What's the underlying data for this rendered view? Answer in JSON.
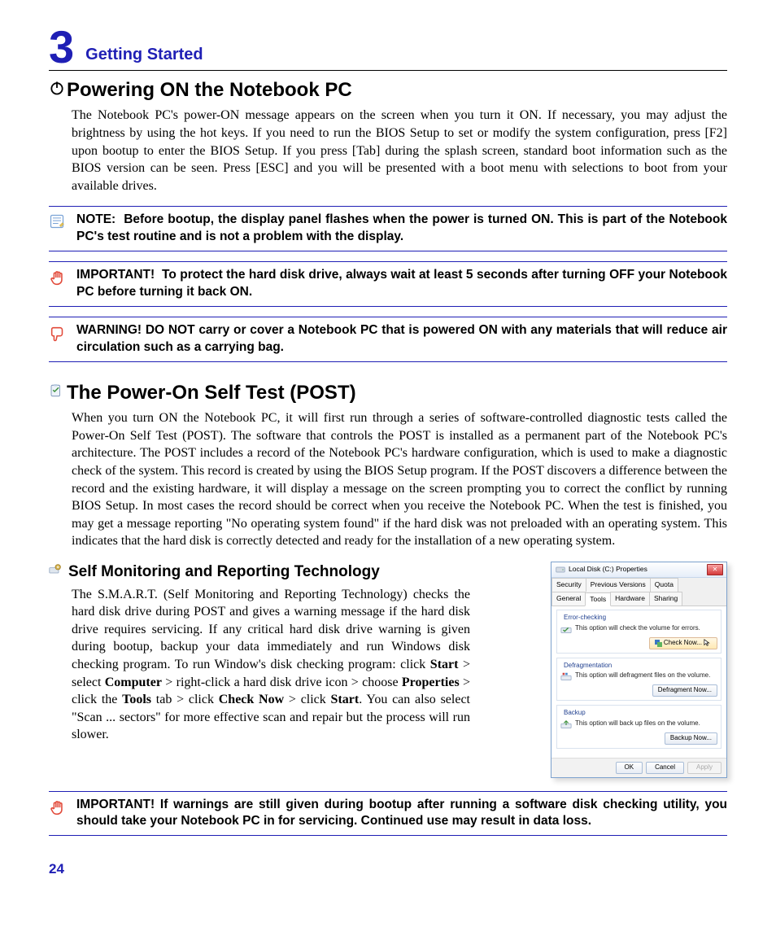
{
  "chapter": {
    "number": "3",
    "title": "Getting Started"
  },
  "section1": {
    "title": "Powering ON the Notebook PC",
    "body": "The Notebook PC's power-ON message appears on the screen when you turn it ON. If necessary, you may adjust the brightness by using the hot keys. If you need to run the BIOS Setup to set or modify the system configuration, press [F2] upon bootup to enter the BIOS Setup. If you press [Tab] during the splash screen, standard boot information such as the BIOS version can be seen. Press [ESC] and you will be presented with a boot menu with selections to boot from your available drives."
  },
  "note": {
    "label": "NOTE:",
    "text": "Before bootup, the display panel flashes when the power is turned ON. This is part of the Notebook PC's test routine and is not a problem with the display."
  },
  "important1": {
    "label": "IMPORTANT!",
    "text": "To protect the hard disk drive, always wait at least 5 seconds after turning OFF your Notebook PC before turning it back ON."
  },
  "warning": {
    "label": "WARNING!",
    "text": "DO NOT carry or cover a Notebook PC that is powered ON with any materials that will reduce air circulation such as a carrying bag."
  },
  "section2": {
    "title": "The Power-On Self Test (POST)",
    "body": "When you turn ON the Notebook PC, it will first run through a series of software-controlled diagnostic tests called the Power-On Self Test (POST). The software that controls the POST is installed as a permanent part of the Notebook PC's architecture. The POST includes a record of the Notebook PC's hardware configuration, which is used to make a diagnostic check of the system. This record is created by using the BIOS Setup program. If the POST discovers a difference between the record and the existing hardware, it will display a message on the screen prompting you to correct the conflict by running BIOS Setup. In most cases the record should be correct when you receive the Notebook PC. When the test is finished, you may get a message reporting \"No operating system found\" if the hard disk was not preloaded with an operating system. This indicates that the hard disk is correctly detected and ready for the installation of a new operating system."
  },
  "subsection": {
    "title": "Self Monitoring and Reporting Technology",
    "body_pre": "The S.M.A.R.T. (Self Monitoring and Reporting Technology) checks the hard disk drive during POST and gives a warning message if the hard disk drive requires servicing. If any critical hard disk drive warning is given during bootup, backup your data immediately and run Windows disk checking program. To run Window's disk checking program: click ",
    "b1": "Start",
    "t1": " > select ",
    "b2": "Computer",
    "t2": " > right-click a hard disk drive icon > choose ",
    "b3": "Properties",
    "t3": " > click the ",
    "b4": "Tools",
    "t4": " tab > click ",
    "b5": "Check Now",
    "t5": " > click ",
    "b6": "Start",
    "t6": ". You can also select \"Scan ... sectors\" for more effective scan and repair but the process will run slower."
  },
  "important2": {
    "label": "IMPORTANT!",
    "text": "If warnings are still given during bootup after running a software disk checking utility, you should take your Notebook PC in for servicing. Continued use may result in data loss."
  },
  "page_number": "24",
  "dialog": {
    "title": "Local Disk (C:) Properties",
    "tabs_row1": [
      "Security",
      "Previous Versions",
      "Quota"
    ],
    "tabs_row2": [
      "General",
      "Tools",
      "Hardware",
      "Sharing"
    ],
    "group1": {
      "title": "Error-checking",
      "text": "This option will check the volume for errors.",
      "button": "Check Now..."
    },
    "group2": {
      "title": "Defragmentation",
      "text": "This option will defragment files on the volume.",
      "button": "Defragment Now..."
    },
    "group3": {
      "title": "Backup",
      "text": "This option will back up files on the volume.",
      "button": "Backup Now..."
    },
    "footer": {
      "ok": "OK",
      "cancel": "Cancel",
      "apply": "Apply"
    }
  }
}
